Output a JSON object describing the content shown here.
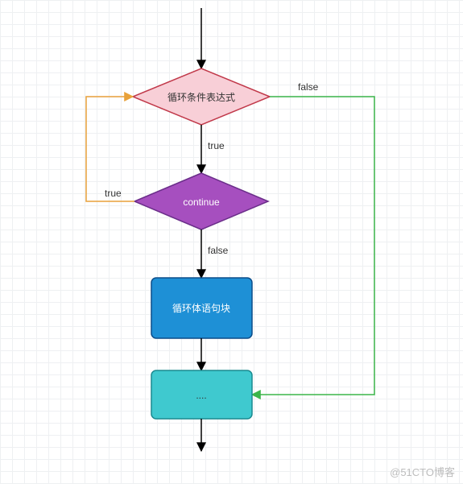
{
  "nodes": {
    "condition": "循环条件表达式",
    "continue": "continue",
    "body": "循环体语句块",
    "end": "...."
  },
  "edges": {
    "cond_false": "false",
    "cond_true": "true",
    "cont_true": "true",
    "cont_false": "false"
  },
  "watermark": "@51CTO博客"
}
